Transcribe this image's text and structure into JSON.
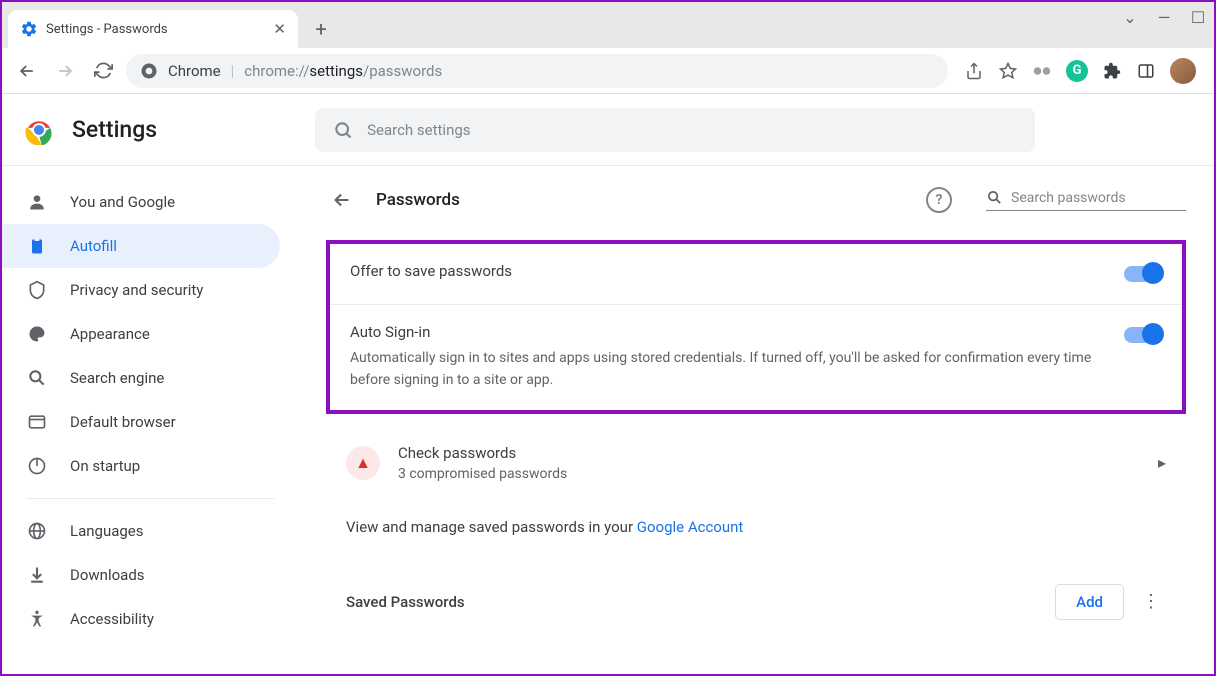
{
  "tab": {
    "title": "Settings - Passwords"
  },
  "addressBar": {
    "scheme_label": "Chrome",
    "url_prefix": "chrome://",
    "url_mid": "settings",
    "url_suffix": "/passwords"
  },
  "settingsHeader": {
    "title": "Settings",
    "search_placeholder": "Search settings"
  },
  "sidebar": {
    "items": [
      {
        "label": "You and Google"
      },
      {
        "label": "Autofill"
      },
      {
        "label": "Privacy and security"
      },
      {
        "label": "Appearance"
      },
      {
        "label": "Search engine"
      },
      {
        "label": "Default browser"
      },
      {
        "label": "On startup"
      }
    ],
    "advanced": [
      {
        "label": "Languages"
      },
      {
        "label": "Downloads"
      },
      {
        "label": "Accessibility"
      }
    ]
  },
  "page": {
    "title": "Passwords",
    "search_placeholder": "Search passwords",
    "offer_label": "Offer to save passwords",
    "auto_label": "Auto Sign-in",
    "auto_desc": "Automatically sign in to sites and apps using stored credentials. If turned off, you'll be asked for confirmation every time before signing in to a site or app.",
    "check_title": "Check passwords",
    "check_sub": "3 compromised passwords",
    "manage_prefix": "View and manage saved passwords in your ",
    "manage_link": "Google Account",
    "saved_title": "Saved Passwords",
    "add_label": "Add"
  }
}
